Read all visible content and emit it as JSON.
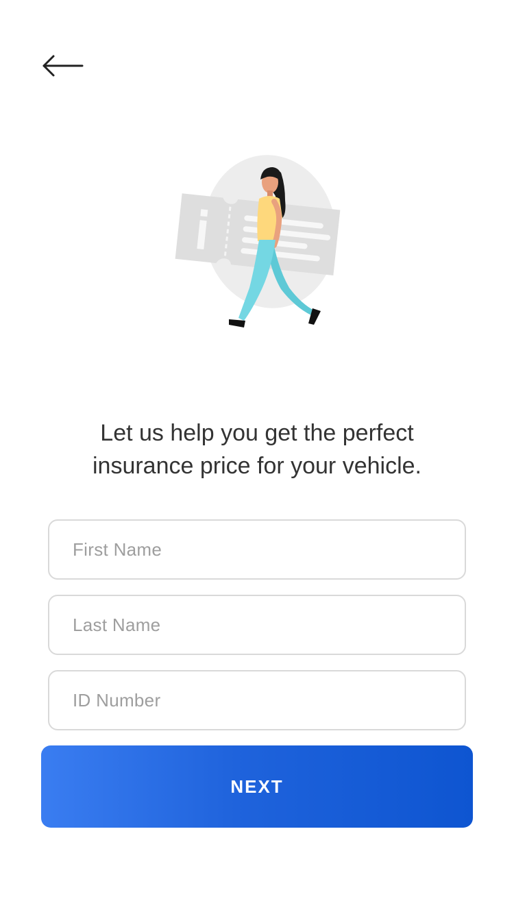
{
  "header": {
    "back_icon": "arrow-left-icon"
  },
  "hero": {
    "illustration": "woman-walking-with-ticket-illustration",
    "headline_line1": "Let us help you get the perfect",
    "headline_line2": "insurance price for your vehicle."
  },
  "form": {
    "first_name": {
      "value": "",
      "placeholder": "First Name"
    },
    "last_name": {
      "value": "",
      "placeholder": "Last Name"
    },
    "id_number": {
      "value": "",
      "placeholder": "ID Number"
    },
    "submit_label": "NEXT"
  },
  "colors": {
    "accent_start": "#3a7df1",
    "accent_end": "#0e55d1",
    "text": "#333333",
    "placeholder": "#9e9e9e",
    "border": "#d9d9d9"
  }
}
